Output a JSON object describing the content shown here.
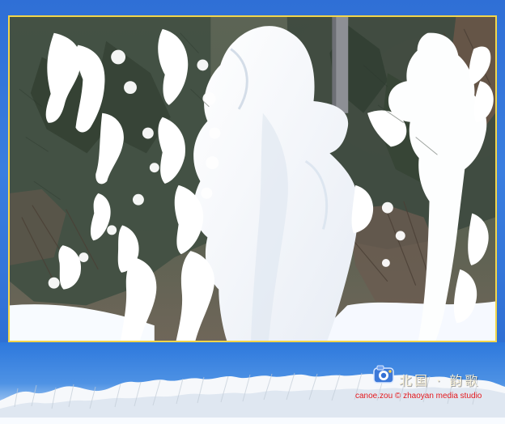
{
  "banner": {
    "title_cn": "北国 · 韵歌",
    "credit": "canoe.zou © zhaoyan media studio"
  },
  "colors": {
    "border_gold": "#f2d54b",
    "frame_blue": "#2f6fd6",
    "credit_red": "#e0151b",
    "title_cream": "#f7f0d8"
  },
  "icons": {
    "logo": "camera-logo-icon"
  }
}
